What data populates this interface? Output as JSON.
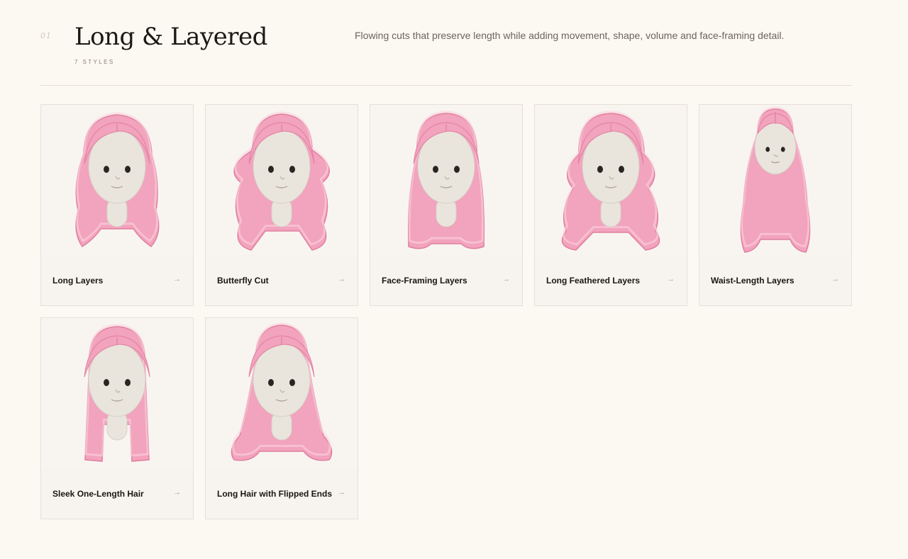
{
  "section": {
    "number": "01",
    "title": "Long & Layered",
    "count": "7 STYLES",
    "description": "Flowing cuts that preserve length while adding movement, shape, volume and face-framing detail."
  },
  "arrow_glyph": "→",
  "cards": [
    {
      "label": "Long Layers",
      "icon": "long-layers-hair-icon",
      "style": "layered"
    },
    {
      "label": "Butterfly Cut",
      "icon": "butterfly-cut-hair-icon",
      "style": "butterfly"
    },
    {
      "label": "Face-Framing Layers",
      "icon": "face-framing-hair-icon",
      "style": "framing"
    },
    {
      "label": "Long Feathered Layers",
      "icon": "feathered-hair-icon",
      "style": "feathered"
    },
    {
      "label": "Waist-Length Layers",
      "icon": "waist-length-hair-icon",
      "style": "waist"
    },
    {
      "label": "Sleek One-Length Hair",
      "icon": "sleek-hair-icon",
      "style": "sleek"
    },
    {
      "label": "Long Hair with Flipped Ends",
      "icon": "flipped-ends-hair-icon",
      "style": "flipped"
    }
  ],
  "colors": {
    "background": "#fcf9f2",
    "hair": "#f2a3bd",
    "hair_shadow": "#e07f9f",
    "hair_highlight": "#fbd3e0",
    "face": "#e9e5dd"
  }
}
